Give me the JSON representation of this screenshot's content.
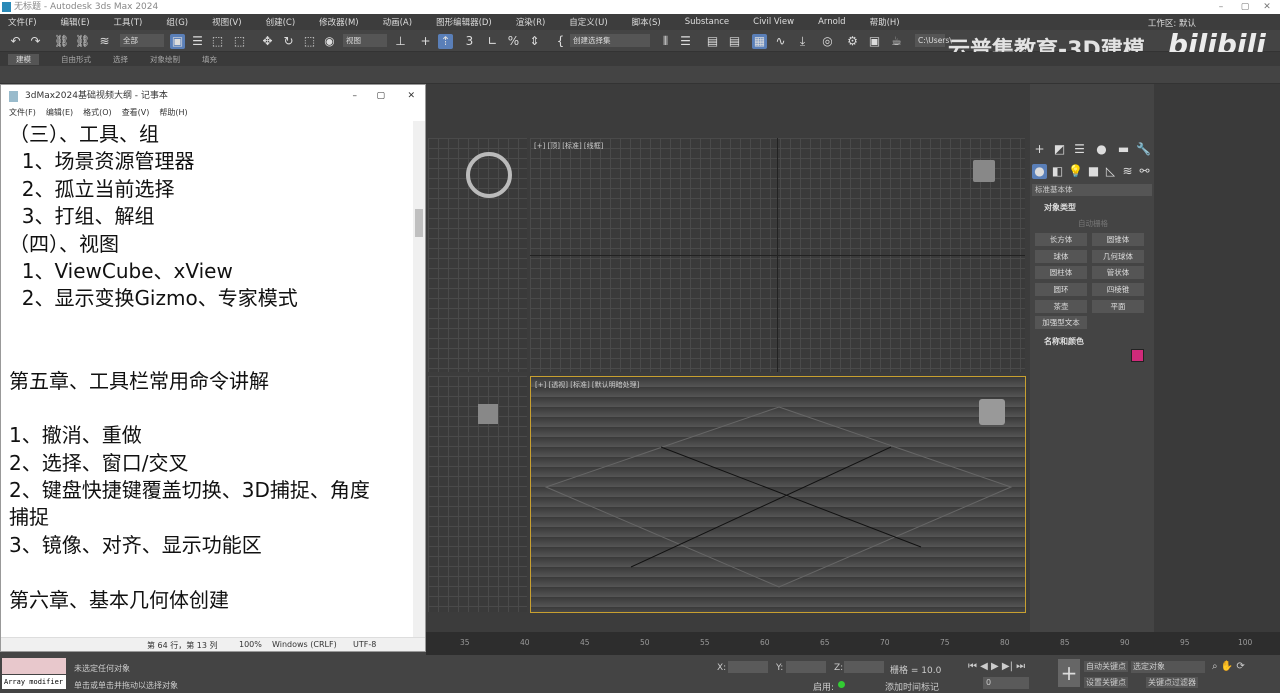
{
  "window": {
    "title": "无标题 - Autodesk 3ds Max 2024",
    "minimize": "–",
    "maximize": "▢",
    "close": "✕"
  },
  "menu": [
    "文件(F)",
    "编辑(E)",
    "工具(T)",
    "组(G)",
    "视图(V)",
    "创建(C)",
    "修改器(M)",
    "动画(A)",
    "图形编辑器(D)",
    "渲染(R)",
    "自定义(U)",
    "脚本(S)",
    "Substance",
    "Civil View",
    "Arnold",
    "帮助(H)"
  ],
  "workspace": "工作区: 默认",
  "toolbar": {
    "filter": "全部",
    "coord": "视图",
    "selset": "创建选择集",
    "path": "C:\\Users\\"
  },
  "ribbon_tabs": [
    "建模",
    "自由形式",
    "选择",
    "对象绘制",
    "填充"
  ],
  "watermark": "云普集教育-3D建模",
  "bili": "bilibili",
  "viewports": {
    "top": "[+] [顶] [标准] [线框]",
    "perspective": "[+] [透视] [标准] [默认明暗处理]"
  },
  "command_panel": {
    "dropdown": "标准基本体",
    "section1": "对象类型",
    "autogrid": "自动栅格",
    "buttons": [
      "长方体",
      "圆锥体",
      "球体",
      "几何球体",
      "圆柱体",
      "管状体",
      "圆环",
      "四棱锥",
      "茶壶",
      "平面"
    ],
    "extra": "加强型文本",
    "section2": "名称和颜色",
    "color": "#d02a7a"
  },
  "timeline": {
    "ticks": [
      "35",
      "40",
      "45",
      "50",
      "55",
      "60",
      "65",
      "70",
      "75",
      "80",
      "85",
      "90",
      "95",
      "100"
    ]
  },
  "status": {
    "script": "Array modifier",
    "line1": "未选定任何对象",
    "line2": "单击或单击并拖动以选择对象",
    "x": "X:",
    "y": "Y:",
    "z": "Z:",
    "grid": "栅格 = 10.0",
    "enable": "启用:",
    "addtime": "添加时间标记",
    "frame": "0",
    "autokey": "自动关键点",
    "setkey": "设置关键点",
    "selobj": "选定对象",
    "keyfilter": "关键点过滤器"
  },
  "notepad": {
    "title": "3dMax2024基础视频大纲 - 记事本",
    "menu": [
      "文件(F)",
      "编辑(E)",
      "格式(O)",
      "查看(V)",
      "帮助(H)"
    ],
    "lines": [
      "（三）、工具、组",
      "  1、场景资源管理器",
      "  2、孤立当前选择",
      "  3、打组、解组",
      "（四）、视图",
      "  1、ViewCube、xView",
      "  2、显示变换Gizmo、专家模式",
      "",
      "",
      "第五章、工具栏常用命令讲解",
      "",
      "1、撤消、重做",
      "2、选择、窗口/交叉",
      "2、键盘快捷键覆盖切换、3D捕捉、角度",
      "捕捉",
      "3、镜像、对齐、显示功能区",
      "",
      "第六章、基本几何体创建"
    ],
    "status": {
      "pos": "第 64 行，第 13 列",
      "zoom": "100%",
      "eol": "Windows (CRLF)",
      "enc": "UTF-8"
    }
  }
}
